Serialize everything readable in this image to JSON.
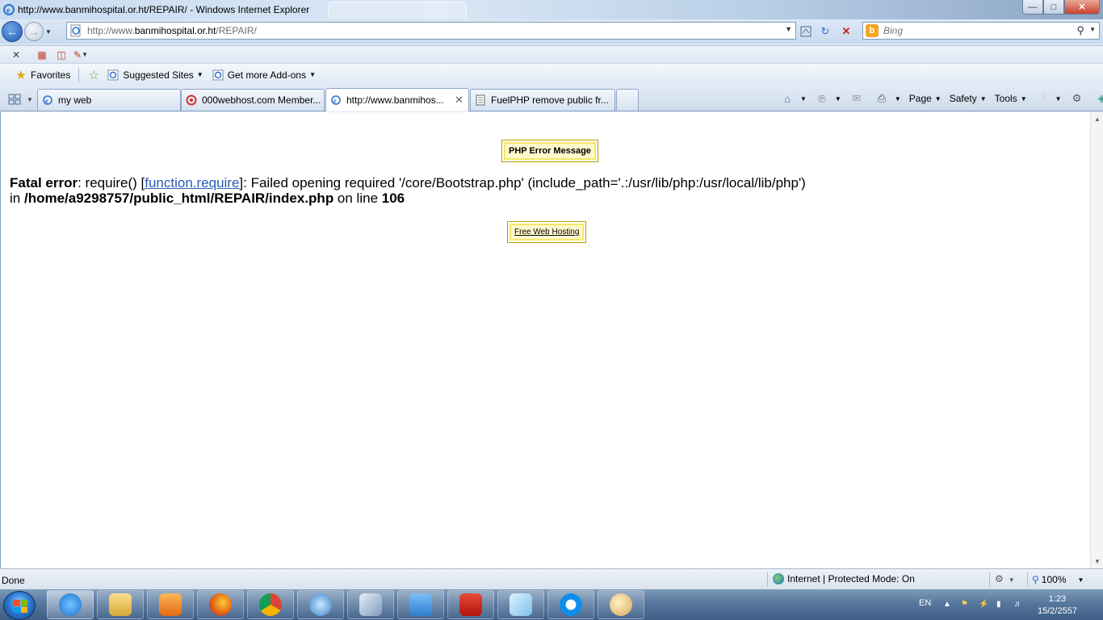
{
  "window": {
    "title": "http://www.banmihospital.or.ht/REPAIR/ - Windows Internet Explorer"
  },
  "address_bar": {
    "url_prefix": "http://www.",
    "url_domain": "banmihospital.or.ht",
    "url_path": "/REPAIR/"
  },
  "search": {
    "placeholder": "Bing"
  },
  "favorites_bar": {
    "favorites_label": "Favorites",
    "suggested_sites_label": "Suggested Sites",
    "addons_label": "Get more Add-ons"
  },
  "tabs": [
    {
      "label": "my web",
      "active": false
    },
    {
      "label": "000webhost.com Member...",
      "active": false
    },
    {
      "label": "http://www.banmihos...",
      "active": true
    },
    {
      "label": "FuelPHP remove public fr...",
      "active": false
    }
  ],
  "command_bar": {
    "page_label": "Page",
    "safety_label": "Safety",
    "tools_label": "Tools"
  },
  "page": {
    "error_box_title": "PHP Error Message",
    "error_heading": "Fatal error",
    "error_part1": ": require() [",
    "error_link": "function.require",
    "error_part2": "]: Failed opening required '/core/Bootstrap.php' (include_path='.:/usr/lib/php:/usr/local/lib/php')",
    "error_in": "in ",
    "error_file": "/home/a9298757/public_html/REPAIR/index.php",
    "error_on_line": " on line ",
    "error_line_number": "106",
    "hosting_link": "Free Web Hosting"
  },
  "status_bar": {
    "status": "Done",
    "zone": "Internet | Protected Mode: On",
    "zoom": "100%"
  },
  "taskbar": {
    "language": "EN",
    "time": "1:23",
    "date": "15/2/2557"
  },
  "colors": {
    "link": "#2a5bb5",
    "error_box_bg": "#fff9cc",
    "error_box_border": "#f6e66b"
  }
}
